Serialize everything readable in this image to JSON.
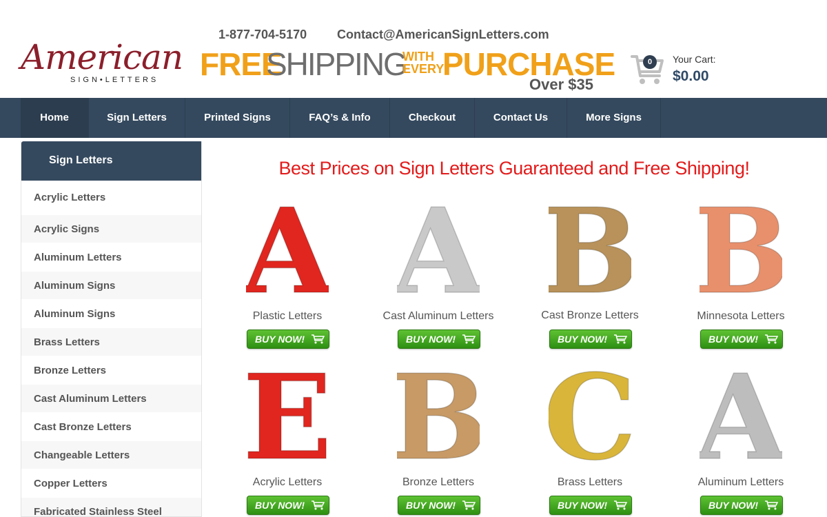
{
  "header": {
    "logo_script": "American",
    "logo_sub": "SIGN•LETTERS",
    "phone": "1-877-704-5170",
    "email": "Contact@AmericanSignLetters.com",
    "banner": {
      "free": "FREE",
      "shipping": "SHIPPING",
      "with": "WITH",
      "every": "EVERY",
      "purchase": "PURCHASE",
      "over": "Over $35"
    },
    "cart": {
      "count": "0",
      "label": "Your Cart:",
      "total": "$0.00",
      "icon": "shopping-cart-icon"
    }
  },
  "nav": [
    "Home",
    "Sign Letters",
    "Printed Signs",
    "FAQ’s & Info",
    "Checkout",
    "Contact Us",
    "More Signs"
  ],
  "sidebar": {
    "title": "Sign Letters",
    "items": [
      "Acrylic Letters",
      "Acrylic Signs",
      "Aluminum Letters",
      "Aluminum Signs",
      "Aluminum Signs",
      "Brass Letters",
      "Bronze Letters",
      "Cast Aluminum Letters",
      "Cast Bronze Letters",
      "Changeable Letters",
      "Copper Letters",
      "Fabricated Stainless Steel"
    ]
  },
  "main": {
    "headline": "Best Prices on Sign Letters Guaranteed and Free Shipping!",
    "buy_label": "BUY NOW!",
    "products": [
      {
        "name": "Plastic Letters",
        "glyph": "A",
        "color": "#e0261f"
      },
      {
        "name": "Cast Aluminum Letters",
        "glyph": "A",
        "color": "#c9c9c9"
      },
      {
        "name": "Cast Bronze Letters",
        "glyph": "B",
        "color": "#b8925a"
      },
      {
        "name": "Minnesota Letters",
        "glyph": "B",
        "color": "#e8906c"
      },
      {
        "name": "Acrylic Letters",
        "glyph": "E",
        "color": "#e0261f"
      },
      {
        "name": "Bronze Letters",
        "glyph": "B",
        "color": "#c79a66"
      },
      {
        "name": "Brass Letters",
        "glyph": "C",
        "color": "#d9b53a"
      },
      {
        "name": "Aluminum Letters",
        "glyph": "A",
        "color": "#bdbdbd"
      }
    ]
  },
  "colors": {
    "nav_bg": "#34495e",
    "headline": "#e31b1b",
    "banner_orange": "#f0a019",
    "buy_green": "#3ea81f"
  }
}
